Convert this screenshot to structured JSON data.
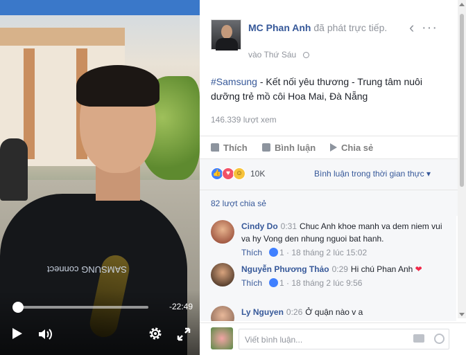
{
  "header": {
    "author": "MC Phan Anh",
    "status": " đã phát trực tiếp.",
    "time": "vào Thứ Sáu"
  },
  "post": {
    "hashtag": "#Samsung",
    "text": " - Kết nối yêu thương - Trung tâm nuôi dưỡng trẻ mồ côi Hoa Mai, Đà Nẵng",
    "views": "146.339 lượt xem"
  },
  "actions": {
    "like": "Thích",
    "comment": "Bình luận",
    "share": "Chia sẻ"
  },
  "reactions": {
    "count": "10K",
    "filter": "Bình luận trong thời gian thực ▾"
  },
  "shares": "82 lượt chia sẻ",
  "video": {
    "timecode": "-22:49",
    "brand": "SAMSUNG connect",
    "progress_fraction": 0.02
  },
  "comments": [
    {
      "name": "Cindy Do",
      "time": "0:31",
      "text": "Chuc Anh khoe manh va dem niem vui va hy Vong den nhung nguoi bat hanh.",
      "like": "Thích",
      "likes": "1",
      "date": "18 tháng 2 lúc 15:02"
    },
    {
      "name": "Nguyễn Phương Thảo",
      "time": "0:29",
      "text": "Hi chú Phan Anh",
      "like": "Thích",
      "likes": "1",
      "date": "18 tháng 2 lúc 9:56"
    },
    {
      "name": "Ly Nguyen",
      "time": "0:26",
      "text": "Ở quận nào v a",
      "like": "",
      "likes": "",
      "date": ""
    }
  ],
  "composer": {
    "placeholder": "Viết bình luận..."
  },
  "icons": [
    "play-icon",
    "volume-icon",
    "gear-icon",
    "fullscreen-icon",
    "back-icon",
    "more-icon",
    "globe-icon",
    "like-icon",
    "comment-icon",
    "share-icon",
    "camera-icon",
    "emoji-icon"
  ]
}
